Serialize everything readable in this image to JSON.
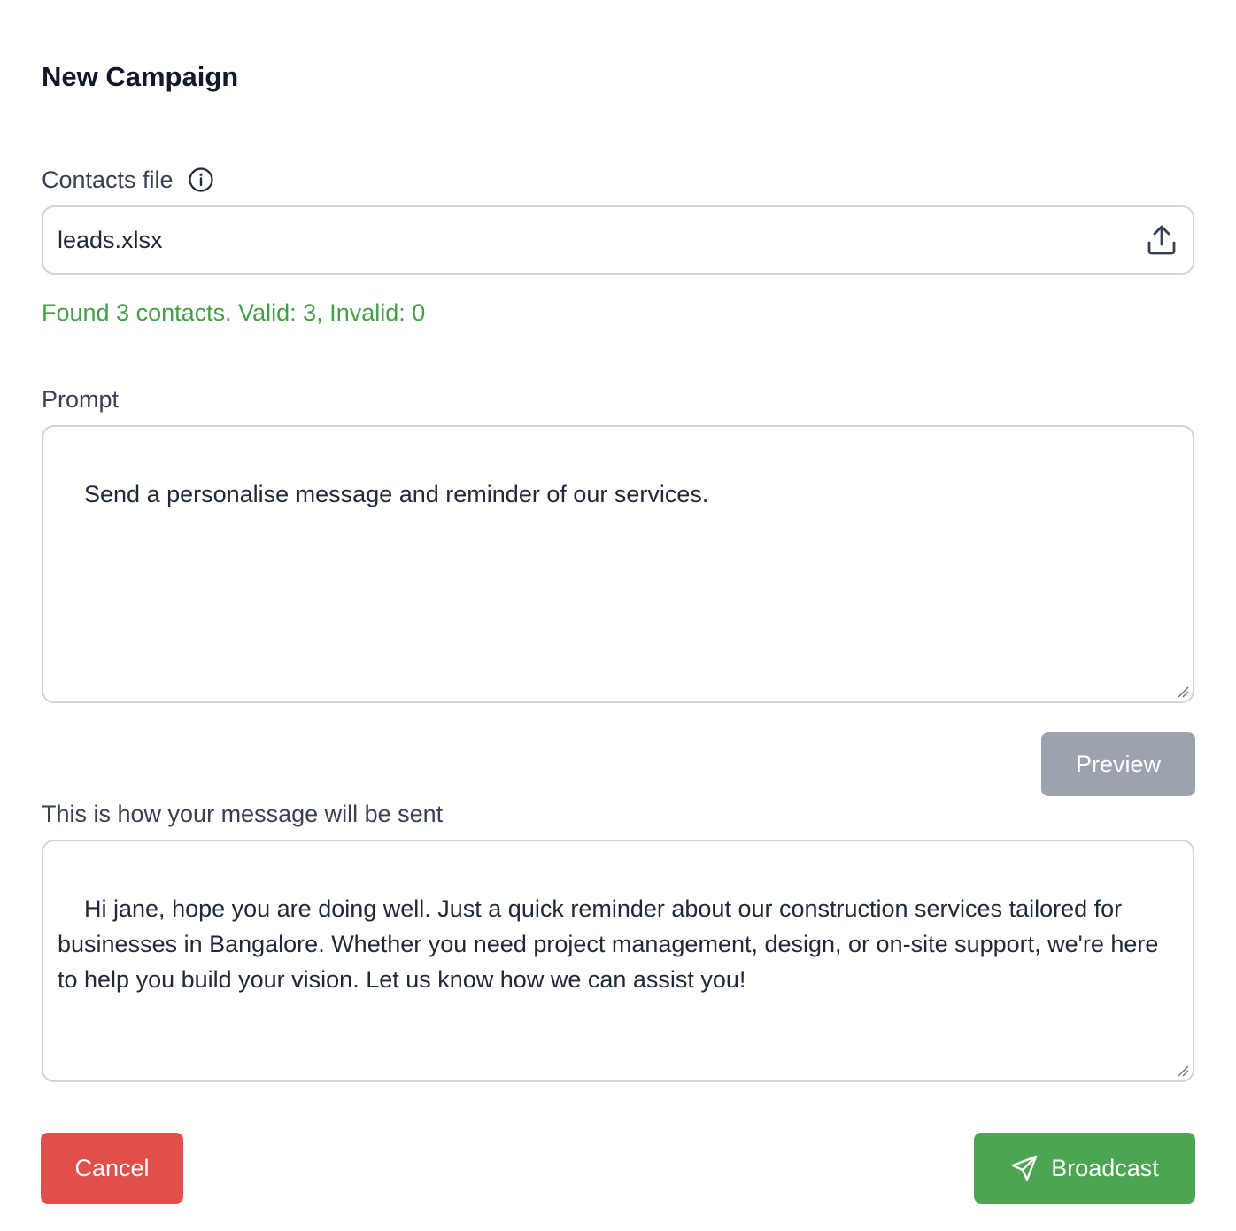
{
  "dialog": {
    "title": "New Campaign"
  },
  "contacts": {
    "label": "Contacts file",
    "file_name": "leads.xlsx",
    "status": "Found 3 contacts. Valid: 3, Invalid: 0",
    "status_color": "#43a047"
  },
  "prompt": {
    "label": "Prompt",
    "value": "Send a personalise message and reminder of our services."
  },
  "preview": {
    "button_label": "Preview",
    "label": "This is how your message will be sent",
    "message": "Hi jane, hope you are doing well. Just a quick reminder about our construction services tailored for businesses in Bangalore. Whether you need project management, design, or on-site support, we're here to help you build your vision. Let us know how we can assist you!"
  },
  "actions": {
    "cancel_label": "Cancel",
    "broadcast_label": "Broadcast"
  },
  "colors": {
    "cancel": "#e04f4a",
    "broadcast": "#4ca552",
    "preview_disabled": "#9ca3af"
  },
  "icons": {
    "info": "info-icon",
    "upload": "upload-icon",
    "send": "send-icon"
  }
}
